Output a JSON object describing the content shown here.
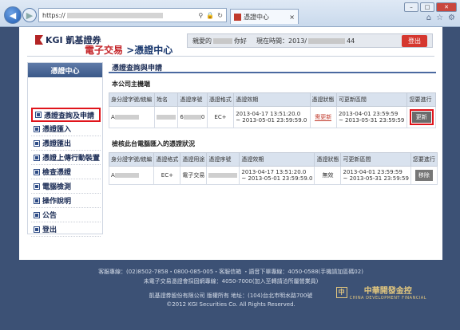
{
  "browser": {
    "url_prefix": "https://",
    "tab_title": "憑證中心",
    "address_icons": [
      "search-icon",
      "lock-icon",
      "refresh-icon"
    ]
  },
  "header": {
    "logo_text": "KGI 凱基證券",
    "breadcrumb_1": "電子交易",
    "breadcrumb_sep": ">",
    "breadcrumb_2": "憑證中心",
    "welcome_prefix": "親愛的",
    "welcome_suffix": "你好",
    "time_label": "現在時間：2013/",
    "time_tail": "44",
    "logout": "登出"
  },
  "sidebar": {
    "title": "憑證中心",
    "items": [
      {
        "label": "憑證查詢及申請",
        "active": true
      },
      {
        "label": "憑證匯入",
        "active": false
      },
      {
        "label": "憑證匯出",
        "active": false
      },
      {
        "label": "憑證上傳行動裝置",
        "active": false
      },
      {
        "label": "檢查憑證",
        "active": false
      },
      {
        "label": "電腦檢測",
        "active": false
      },
      {
        "label": "操作說明",
        "active": false
      },
      {
        "label": "公告",
        "active": false
      },
      {
        "label": "登出",
        "active": false
      }
    ]
  },
  "main": {
    "title": "憑證查詢與申請",
    "section1": "本公司主機端",
    "table1": {
      "headers": [
        "身分證字號/統編",
        "姓名",
        "憑證序號",
        "憑證格式",
        "憑證效期",
        "憑證狀態",
        "可更新區間",
        "您要進行"
      ],
      "row": {
        "id": "A",
        "serial": "6",
        "serial_tail": "0",
        "format": "EC+",
        "validity_1": "2013-04-17 13:51:20.0",
        "validity_2": "~ 2013-05-01 23:59:59.0",
        "status": "需更新",
        "window_1": "2013-04-01 23:59:59",
        "window_2": "~ 2013-05-31 23:59:59",
        "action": "更新"
      }
    },
    "section2": "檢核此台電腦匯入的憑證狀況",
    "table2": {
      "headers": [
        "身分證字號/統編",
        "憑證格式",
        "憑證用途",
        "憑證序號",
        "憑證效期",
        "憑證狀態",
        "可更新區間",
        "您要進行"
      ],
      "row": {
        "id": "A",
        "format": "EC+",
        "usage": "電子交易",
        "validity_1": "2013-04-17 13:51:20.0",
        "validity_2": "~ 2013-05-01 23:59:59.0",
        "status": "無效",
        "window_1": "2013-04-01 23:59:59",
        "window_2": "~ 2013-05-31 23:59:59",
        "action": "移除"
      }
    }
  },
  "footer": {
    "line1": "客服專線：(02)8502-7858・0800-085-005・客服信箱 ・語音下單專線：4050-0588(手機請加區碼02)",
    "line2": "未電子交易憑證會採固網專線：4050-7000(加入至轉請洽所屬營業員)",
    "line3": "凱基證券股份有限公司 版權所有 地址：(104)台北市明水路700號",
    "line4": "©2012 KGI Securities Co. All Rights Reserved.",
    "brand": "中華開發金控",
    "brand_en": "CHINA DEVELOPMENT FINANCIAL"
  }
}
